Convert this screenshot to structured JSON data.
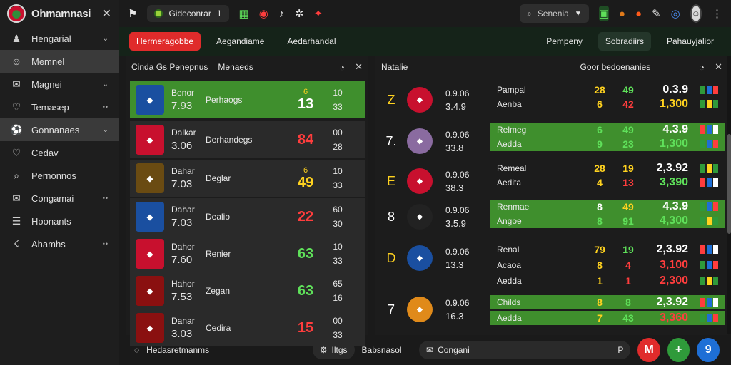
{
  "app": {
    "name": "Ohmamnasi"
  },
  "sidebar": {
    "items": [
      {
        "label": "Hengarial",
        "icon": "people-icon",
        "trailing": "chevron"
      },
      {
        "label": "Memnel",
        "icon": "user-icon",
        "trailing": "",
        "active": true
      },
      {
        "label": "Magnei",
        "icon": "chat-icon",
        "trailing": "chevron"
      },
      {
        "label": "Temasep",
        "icon": "heart-icon",
        "trailing": "dots"
      },
      {
        "label": "Gonnanaes",
        "icon": "soccer-icon",
        "trailing": "chevron",
        "active": true
      },
      {
        "label": "Cedav",
        "icon": "heart-icon",
        "trailing": ""
      },
      {
        "label": "Pernonnos",
        "icon": "search-icon",
        "trailing": ""
      },
      {
        "label": "Congamai",
        "icon": "chat-icon",
        "trailing": "dots"
      },
      {
        "label": "Hoonants",
        "icon": "document-icon",
        "trailing": ""
      },
      {
        "label": "Ahamhs",
        "icon": "bolt-icon",
        "trailing": "dots"
      }
    ]
  },
  "topbar": {
    "pill_label": "Gideconrar",
    "pill_count": "1",
    "search_label": "Senenia"
  },
  "tabs": {
    "left": [
      "Hermeragobbe",
      "Aegandiame",
      "Aedarhandal"
    ],
    "right": [
      "Pempeny",
      "Sobradiirs",
      "Pahauyjalior"
    ]
  },
  "left_panel": {
    "header_left": "Cinda Gs Penepnus",
    "header_mid": "Menaeds",
    "rows": [
      {
        "c1": "Benor",
        "c1b": "7.93",
        "c2": "Perhaogs",
        "c3a": "6",
        "c3b": "13",
        "c4a": "10",
        "c4b": "33",
        "c3color": "#ffffff",
        "green": true,
        "crest": "#1a4fa0"
      },
      {
        "c1": "Dalkar",
        "c1b": "3.06",
        "c2": "Derhandegs",
        "c3a": "",
        "c3b": "84",
        "c4a": "00",
        "c4b": "28",
        "c3color": "#ff3d3d",
        "green": false,
        "crest": "#c8102e"
      },
      {
        "c1": "Dahar",
        "c1b": "7.03",
        "c2": "Deglar",
        "c3a": "6",
        "c3b": "49",
        "c4a": "10",
        "c4b": "33",
        "c3color": "#ffd21f",
        "green": false,
        "crest": "#6a4b12"
      },
      {
        "c1": "Dahar",
        "c1b": "7.03",
        "c2": "Dealio",
        "c3a": "",
        "c3b": "22",
        "c4a": "60",
        "c4b": "30",
        "c3color": "#ff3d3d",
        "green": false,
        "crest": "#1a4fa0"
      },
      {
        "c1": "Dahor",
        "c1b": "7.60",
        "c2": "Renier",
        "c3a": "",
        "c3b": "63",
        "c4a": "10",
        "c4b": "33",
        "c3color": "#5fe05a",
        "green": false,
        "crest": "#c8102e"
      },
      {
        "c1": "Hahor",
        "c1b": "7.53",
        "c2": "Zegan",
        "c3a": "",
        "c3b": "63",
        "c4a": "65",
        "c4b": "16",
        "c3color": "#5fe05a",
        "green": false,
        "crest": "#8a1010"
      },
      {
        "c1": "Danar",
        "c1b": "3.03",
        "c2": "Cedira",
        "c3a": "",
        "c3b": "15",
        "c4a": "00",
        "c4b": "33",
        "c3color": "#ff3d3d",
        "green": false,
        "crest": "#8a1010"
      }
    ]
  },
  "right_panel": {
    "header_left": "Natalie",
    "header_mid": "Goor bedoenanies",
    "groups": [
      {
        "rank": "Z",
        "crest": "#c8102e",
        "n1": "0.9.06",
        "n2": "3.4.9"
      },
      {
        "rank": "7.",
        "crest": "#8a6ba0",
        "n1": "0.9.06",
        "n2": "33.8"
      },
      {
        "rank": "E",
        "crest": "#c8102e",
        "n1": "0.9.06",
        "n2": "38.3"
      },
      {
        "rank": "8",
        "crest": "#222222",
        "n1": "0.9.06",
        "n2": "3.5.9"
      },
      {
        "rank": "D",
        "crest": "#1a4fa0",
        "n1": "0.9.06",
        "n2": "13.3"
      },
      {
        "rank": "7",
        "crest": "#e08a1a",
        "n1": "0.9.06",
        "n2": "16.3"
      }
    ],
    "lines": [
      {
        "name": "Pampal",
        "v1": "28",
        "v2": "49",
        "v3": "0.3.9",
        "v1c": "#ffd21f",
        "v2c": "#5fe05a",
        "v3c": "#ffffff",
        "green": false
      },
      {
        "name": "Aenba",
        "v1": "6",
        "v2": "42",
        "v3": "1,300",
        "v1c": "#ffd21f",
        "v2c": "#ff3d3d",
        "v3c": "#ffd21f",
        "green": false
      },
      {
        "name": "Relmeg",
        "v1": "6",
        "v2": "49",
        "v3": "4.3.9",
        "v1c": "#5fe05a",
        "v2c": "#5fe05a",
        "v3c": "#ffffff",
        "green": true
      },
      {
        "name": "Aedda",
        "v1": "9",
        "v2": "23",
        "v3": "1,300",
        "v1c": "#5fe05a",
        "v2c": "#5fe05a",
        "v3c": "#5fe05a",
        "green": true
      },
      {
        "name": "Remeal",
        "v1": "28",
        "v2": "19",
        "v3": "2,3.92",
        "v1c": "#ffd21f",
        "v2c": "#ffd21f",
        "v3c": "#ffffff",
        "green": false
      },
      {
        "name": "Aedita",
        "v1": "4",
        "v2": "13",
        "v3": "3,390",
        "v1c": "#ffd21f",
        "v2c": "#ff3d3d",
        "v3c": "#5fe05a",
        "green": false
      },
      {
        "name": "Renmae",
        "v1": "8",
        "v2": "49",
        "v3": "4.3.9",
        "v1c": "#ffffff",
        "v2c": "#ffd21f",
        "v3c": "#ffffff",
        "green": true
      },
      {
        "name": "Angoe",
        "v1": "8",
        "v2": "91",
        "v3": "4,300",
        "v1c": "#5fe05a",
        "v2c": "#5fe05a",
        "v3c": "#5fe05a",
        "green": true
      },
      {
        "name": "Renal",
        "v1": "79",
        "v2": "19",
        "v3": "2,3.92",
        "v1c": "#ffd21f",
        "v2c": "#5fe05a",
        "v3c": "#ffffff",
        "green": false
      },
      {
        "name": "Acaoa",
        "v1": "8",
        "v2": "4",
        "v3": "3,100",
        "v1c": "#ffd21f",
        "v2c": "#ff3d3d",
        "v3c": "#ff3d3d",
        "green": false
      },
      {
        "name": "Aedda",
        "v1": "1",
        "v2": "1",
        "v3": "2,300",
        "v1c": "#ffd21f",
        "v2c": "#ff3d3d",
        "v3c": "#ff3d3d",
        "green": false
      },
      {
        "name": "Childs",
        "v1": "8",
        "v2": "8",
        "v3": "2,3.92",
        "v1c": "#ffd21f",
        "v2c": "#5fe05a",
        "v3c": "#ffffff",
        "green": true
      },
      {
        "name": "Aedda",
        "v1": "7",
        "v2": "43",
        "v3": "3,360",
        "v1c": "#ffd21f",
        "v2c": "#5fe05a",
        "v3c": "#ff3d3d",
        "green": true
      }
    ]
  },
  "bottombar": {
    "left_label": "Hedasretmanms",
    "mid_label": "Iltgs",
    "mid_label2": "Babsnasol",
    "chip_label": "Congani",
    "fab1": "M",
    "fab2": "+",
    "fab3": "9"
  },
  "colors": {
    "accent_red": "#e02b2b",
    "accent_green": "#3f8f2d",
    "bg": "#1a1a1a"
  }
}
